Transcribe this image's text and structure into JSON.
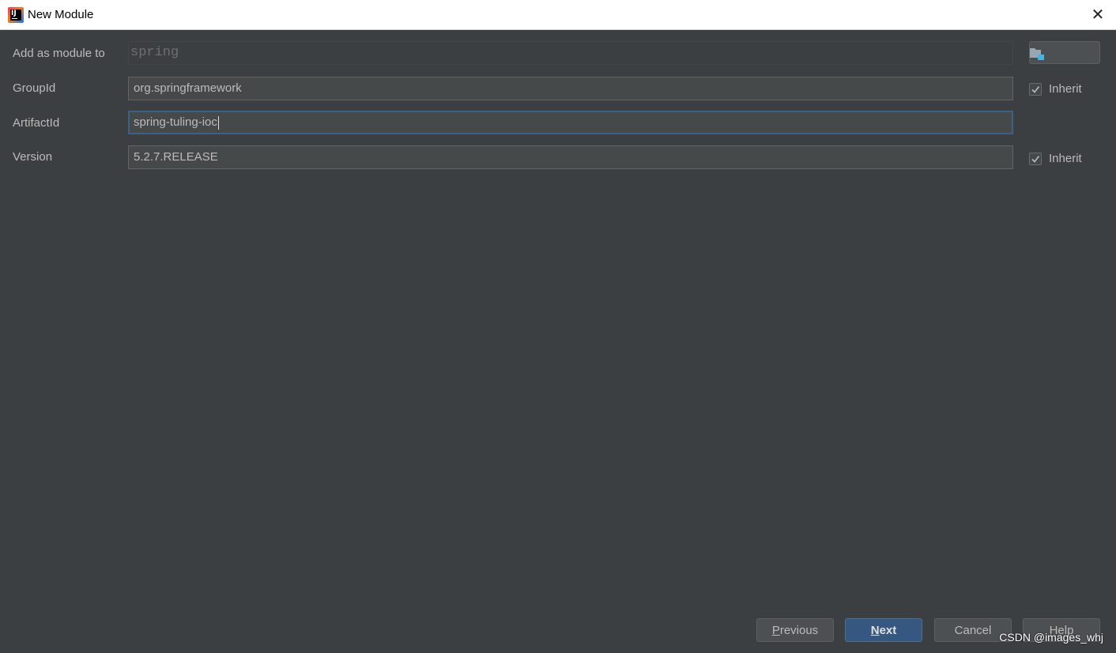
{
  "window": {
    "title": "New Module",
    "close_glyph": "✕"
  },
  "form": {
    "parent": {
      "label": "Add as module to",
      "value": "spring"
    },
    "group_id": {
      "label": "GroupId",
      "value": "org.springframework",
      "inherit_label": "Inherit",
      "inherit_checked": true
    },
    "artifact_id": {
      "label": "ArtifactId",
      "value": "spring-tuling-ioc"
    },
    "version": {
      "label": "Version",
      "value": "5.2.7.RELEASE",
      "inherit_label": "Inherit",
      "inherit_checked": true
    }
  },
  "buttons": {
    "previous": {
      "mnemonic": "P",
      "rest": "revious"
    },
    "next": {
      "mnemonic": "N",
      "rest": "ext"
    },
    "cancel": {
      "label": "Cancel"
    },
    "help": {
      "label": "Help"
    }
  },
  "watermark": "CSDN @images_whj",
  "icons": {
    "app": "intellij-idea-icon",
    "browse": "folder-icon",
    "close": "close-icon",
    "check": "check-icon"
  },
  "colors": {
    "background": "#3c3f41",
    "field_bg": "#45494a",
    "focus_border": "#3d6185",
    "primary_button": "#365880",
    "text": "#bbbbbb"
  }
}
